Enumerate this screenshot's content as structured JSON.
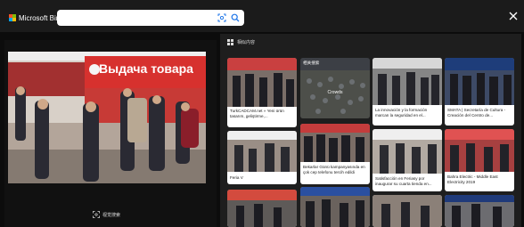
{
  "app": {
    "brand": "Microsoft Bing",
    "logo_colors": [
      "#f35325",
      "#81bc06",
      "#05a6f0",
      "#ffba08"
    ]
  },
  "search": {
    "value": "",
    "placeholder": ""
  },
  "main_image": {
    "sign_text": "Выдача товара"
  },
  "left": {
    "visual_search_label": "视觉搜索"
  },
  "related": {
    "header": "相似内容",
    "cards": [
      {
        "caption": "TurkCADCAM.net » Yeni ürün tasarım, geliştirme,..."
      },
      {
        "overlay": "相关搜索",
        "center_label": "Crowds"
      },
      {
        "caption": "La innovación y la formación marcan la seguridad en el..."
      },
      {
        "caption": "SMATA | Secretaría de Cultura - Creación del Centro de..."
      },
      {
        "caption": "Feria V"
      },
      {
        "caption": "Bekarlar Günü kampanyasında en çok cep telefonu tercih edildi"
      },
      {
        "caption": "Satisfacción en Feriasy por inaugurar su cuarta tienda en..."
      },
      {
        "caption": "Bahra Electric - Middle East Electricity 2019"
      }
    ]
  }
}
